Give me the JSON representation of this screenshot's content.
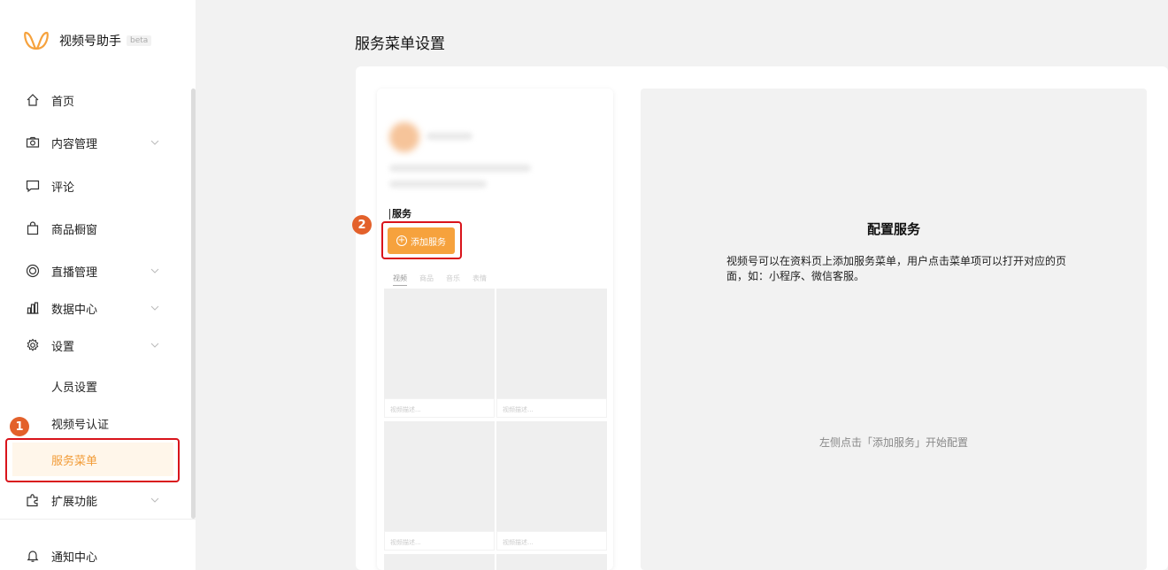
{
  "app": {
    "name": "视频号助手",
    "badge": "beta"
  },
  "sidebar": {
    "items": [
      {
        "label": "首页",
        "icon": "home-icon"
      },
      {
        "label": "内容管理",
        "icon": "camera-icon"
      },
      {
        "label": "评论",
        "icon": "comment-icon"
      },
      {
        "label": "商品橱窗",
        "icon": "shopping-bag-icon"
      },
      {
        "label": "直播管理",
        "icon": "live-icon"
      },
      {
        "label": "数据中心",
        "icon": "chart-icon"
      },
      {
        "label": "设置",
        "icon": "gear-icon"
      },
      {
        "label": "扩展功能",
        "icon": "puzzle-icon"
      },
      {
        "label": "通知中心",
        "icon": "bell-icon"
      }
    ],
    "sub_items": [
      {
        "label": "人员设置"
      },
      {
        "label": "视频号认证"
      },
      {
        "label": "服务菜单",
        "active": true
      }
    ]
  },
  "annotations": {
    "step1": "1",
    "step2": "2"
  },
  "main": {
    "title": "服务菜单设置",
    "preview": {
      "section_label": "服务",
      "add_button": "添加服务",
      "tabs": [
        "视频",
        "商品",
        "音乐",
        "表情"
      ],
      "tile_caption": "视频描述..."
    },
    "config": {
      "title": "配置服务",
      "description": "视频号可以在资料页上添加服务菜单，用户点击菜单项可以打开对应的页面，如：小程序、微信客服。",
      "hint": "左侧点击「添加服务」开始配置"
    }
  },
  "colors": {
    "accent": "#f29c38",
    "highlight": "#d9141b",
    "badge": "#e3612b"
  }
}
